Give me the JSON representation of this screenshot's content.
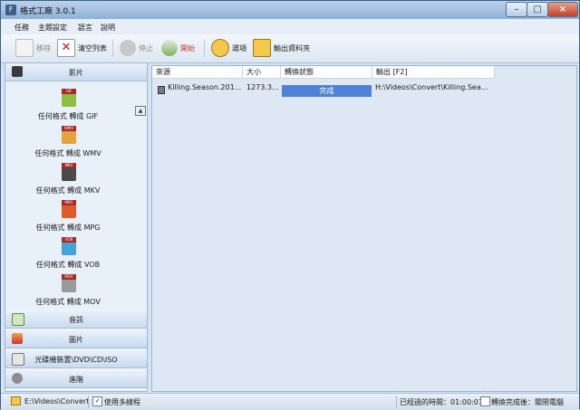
{
  "window": {
    "title": "格式工廠 3.0.1",
    "minimize_glyph": "–",
    "maximize_glyph": "□",
    "close_glyph": "×"
  },
  "menu": [
    "任務",
    "主題設定",
    "語言",
    "說明"
  ],
  "toolbar": {
    "remove": "移除",
    "clear_list": "清空列表",
    "stop": "停止",
    "start": "開始",
    "options": "選項",
    "output_folder": "輸出資料夾"
  },
  "sidebar": {
    "video_header": "影片",
    "formats": [
      {
        "tag": "GIF",
        "label": "任何格式 轉成 GIF",
        "color": "#8fbf3f"
      },
      {
        "tag": "WMV",
        "label": "任何格式 轉成 WMV",
        "color": "#e6a23c"
      },
      {
        "tag": "MKV",
        "label": "任何格式 轉成 MKV",
        "color": "#4a4a4a"
      },
      {
        "tag": "MPG",
        "label": "任何格式 轉成 MPG",
        "color": "#e05a2a"
      },
      {
        "tag": "VOB",
        "label": "任何格式 轉成 VOB",
        "color": "#4aa0d8"
      },
      {
        "tag": "MOV",
        "label": "任何格式 轉成 MOV",
        "color": "#9a9a9a"
      }
    ],
    "audio_header": "音訊",
    "image_header": "圖片",
    "dvd_header": "光碟機裝置\\DVD\\CD\\ISO",
    "advanced_header": "進階"
  },
  "table": {
    "headers": [
      "來源",
      "大小",
      "轉換狀態",
      "輸出 [F2]"
    ],
    "rows": [
      {
        "source": "Killing.Season.201...",
        "size": "1273.3...",
        "status": "完成",
        "output": "H:\\Videos\\Convert\\Killing.Sea..."
      }
    ]
  },
  "statusbar": {
    "output_path": "E:\\Videos\\Convert",
    "multithread": "使用多線程",
    "elapsed": "已經過的時間：01:00:01",
    "after_convert": "轉換完成後：關閉電腦"
  },
  "colors": {
    "progress_done": "#4f81d6",
    "accent": "#3d5f86"
  }
}
